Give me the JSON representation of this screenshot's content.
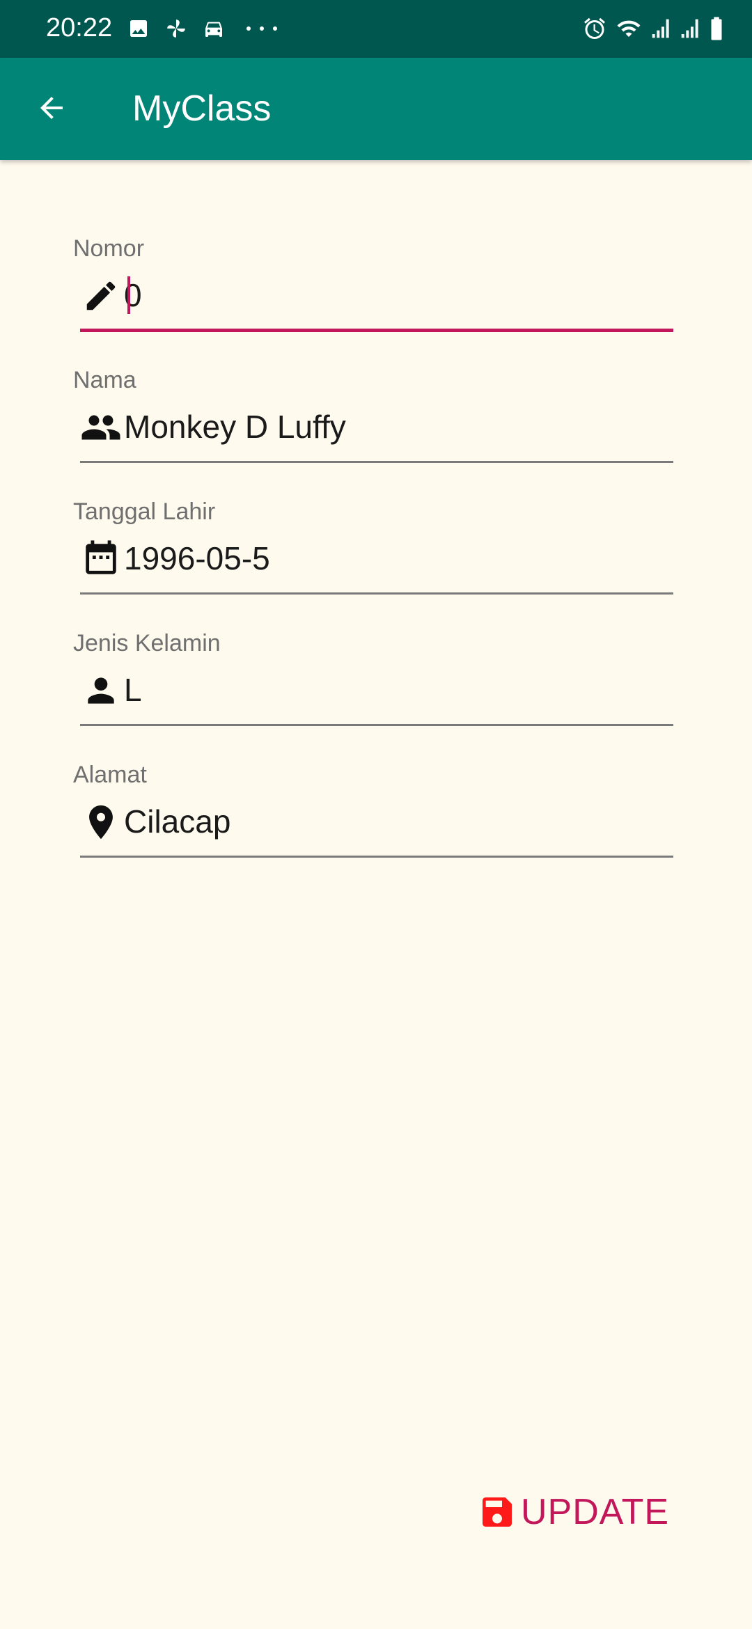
{
  "status_bar": {
    "time": "20:22",
    "left_icons": [
      "image-icon",
      "pinwheel-icon",
      "car-icon",
      "more-dots-icon"
    ],
    "right_icons": [
      "alarm-icon",
      "wifi-icon",
      "signal-icon",
      "signal-icon",
      "battery-icon"
    ],
    "background_color": "#00574f"
  },
  "toolbar": {
    "title": "MyClass",
    "back_icon": "arrow-back-icon",
    "background_color": "#008577"
  },
  "form": {
    "fields": [
      {
        "label": "Nomor",
        "value": "0",
        "icon": "pencil-icon",
        "focused": true
      },
      {
        "label": "Nama",
        "value": "Monkey D Luffy",
        "icon": "people-icon",
        "focused": false
      },
      {
        "label": "Tanggal Lahir",
        "value": "1996-05-5",
        "icon": "calendar-icon",
        "focused": false
      },
      {
        "label": "Jenis Kelamin",
        "value": "L",
        "icon": "person-icon",
        "focused": false
      },
      {
        "label": "Alamat",
        "value": "Cilacap",
        "icon": "location-pin-icon",
        "focused": false
      }
    ]
  },
  "actions": {
    "update_label": "UPDATE",
    "update_icon": "save-icon",
    "update_icon_color": "#ff1a1a",
    "update_text_color": "#c2185b"
  },
  "colors": {
    "background": "#fffaee",
    "accent": "#c2185b"
  }
}
